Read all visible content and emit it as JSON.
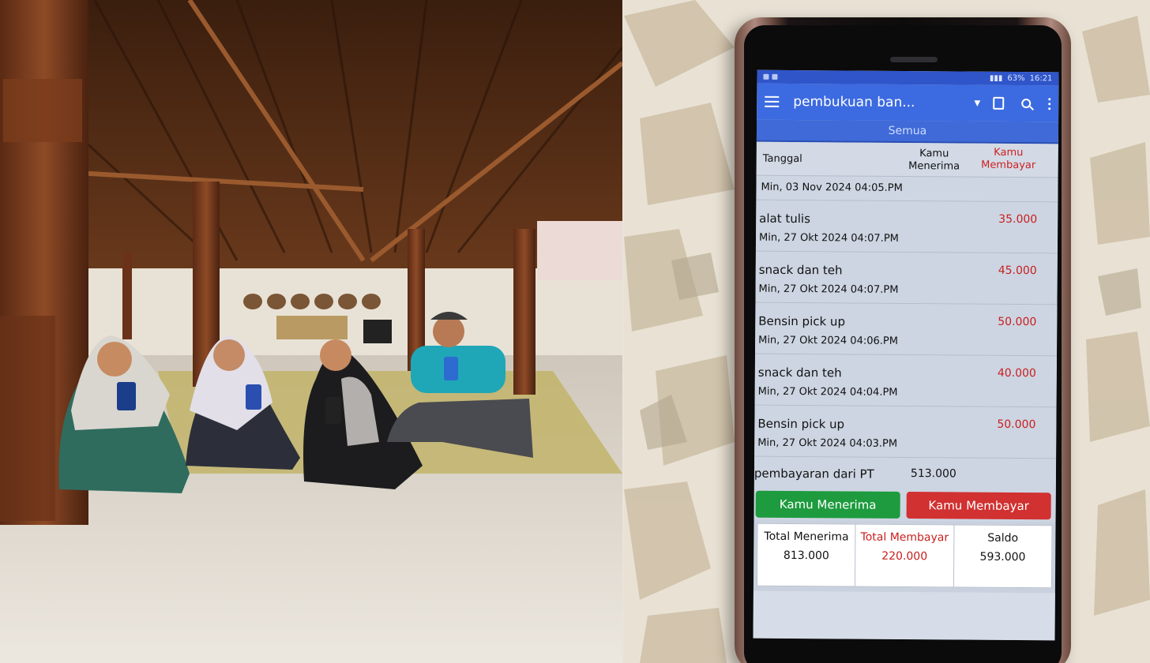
{
  "phone_app": {
    "status_bar": {
      "battery": "63%",
      "time": "16:21"
    },
    "app_bar": {
      "title": "pembukuan ban..."
    },
    "tab": {
      "label": "Semua"
    },
    "columns": {
      "date": "Tanggal",
      "received": "Kamu Menerima",
      "paid": "Kamu Membayar"
    },
    "group_date": "Min, 03 Nov 2024 04:05.PM",
    "transactions": [
      {
        "name": "alat tulis",
        "datetime": "Min, 27 Okt 2024 04:07.PM",
        "amount": "35.000"
      },
      {
        "name": "snack dan teh",
        "datetime": "Min, 27 Okt 2024 04:07.PM",
        "amount": "45.000"
      },
      {
        "name": "Bensin pick up",
        "datetime": "Min, 27 Okt 2024 04:06.PM",
        "amount": "50.000"
      },
      {
        "name": "snack dan teh",
        "datetime": "Min, 27 Okt 2024 04:04.PM",
        "amount": "40.000"
      },
      {
        "name": "Bensin pick up",
        "datetime": "Min, 27 Okt 2024 04:03.PM",
        "amount": "50.000"
      }
    ],
    "summary_row": {
      "name": "pembayaran dari PT",
      "amount": "513.000"
    },
    "buttons": {
      "receive": "Kamu Menerima",
      "pay": "Kamu Membayar"
    },
    "totals": {
      "received_label": "Total Menerima",
      "received_value": "813.000",
      "paid_label": "Total Membayar",
      "paid_value": "220.000",
      "balance_label": "Saldo",
      "balance_value": "593.000"
    },
    "colors": {
      "app_bar": "#3c6ae0",
      "receive_button": "#1d9b3e",
      "pay_button": "#d13131",
      "expense_text": "#c81e1e"
    }
  }
}
